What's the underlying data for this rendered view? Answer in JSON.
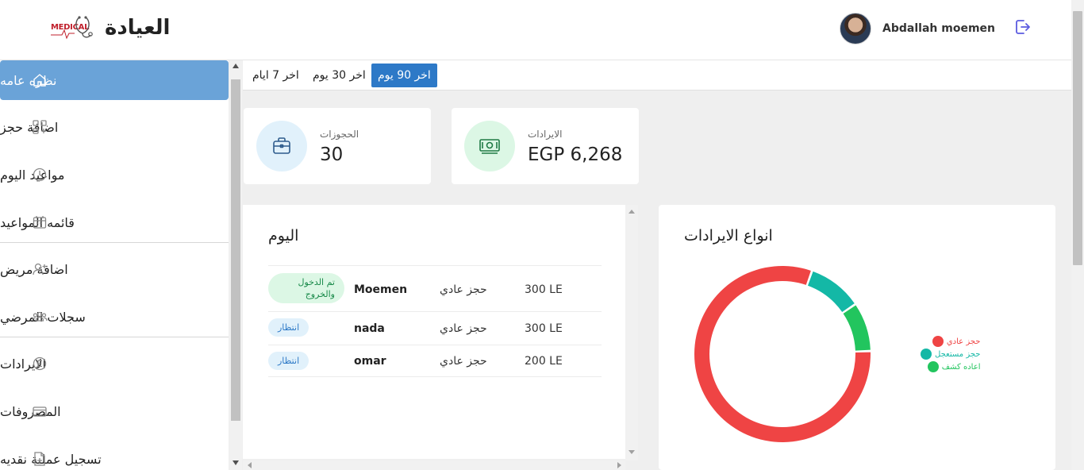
{
  "header": {
    "brand_title": "العيادة",
    "logo_text": "MEDICAL",
    "user_name": "Abdallah moemen"
  },
  "sidebar": {
    "items": [
      {
        "label": "نظره عامه",
        "icon": "home-icon",
        "active": true
      },
      {
        "label": "اضافة حجز",
        "icon": "grid-plus-icon"
      },
      {
        "label": "مواعيد اليوم",
        "icon": "clock-icon"
      },
      {
        "label": "قائمه المواعيد",
        "icon": "calendar-icon"
      },
      {
        "label": "اضافة مريض",
        "icon": "user-plus-icon"
      },
      {
        "label": "سجلات المرضي",
        "icon": "users-icon"
      },
      {
        "label": "الايرادات",
        "icon": "pound-icon"
      },
      {
        "label": "المصروفات",
        "icon": "card-icon"
      },
      {
        "label": "تسجيل عملية نقديه",
        "icon": "file-plus-icon"
      }
    ]
  },
  "period": {
    "tabs": [
      {
        "label": "اخر 90 يوم",
        "active": true
      },
      {
        "label": "اخر 30 يوم",
        "active": false
      },
      {
        "label": "اخر 7 ايام",
        "active": false
      }
    ]
  },
  "stats": {
    "bookings_label": "الحجوزات",
    "bookings_value": "30",
    "revenue_label": "الايرادات",
    "revenue_value": "EGP 6,268"
  },
  "today": {
    "title": "اليوم",
    "rows": [
      {
        "price": "300 LE",
        "type": "حجز عادي",
        "name": "Moemen",
        "status": "تم الدخول والخروج",
        "status_kind": "done"
      },
      {
        "price": "300 LE",
        "type": "حجز عادي",
        "name": "nada",
        "status": "انتظار",
        "status_kind": "wait"
      },
      {
        "price": "200 LE",
        "type": "حجز عادي",
        "name": "omar",
        "status": "انتظار",
        "status_kind": "wait"
      }
    ]
  },
  "chart_data": {
    "type": "pie",
    "title": "انواع الايرادات",
    "categories": [
      "حجز عادي",
      "حجز مستعجل",
      "اعاده كشف"
    ],
    "values": [
      81,
      10,
      9
    ],
    "colors": [
      "#ef4444",
      "#14b8a6",
      "#22c55e"
    ],
    "legend": "right"
  },
  "colors": {
    "accent": "#2d79c7",
    "sidebar_active": "#6aa3d8"
  }
}
